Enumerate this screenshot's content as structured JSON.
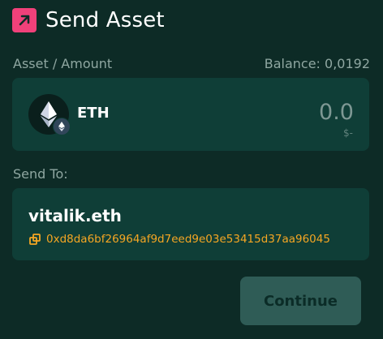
{
  "header": {
    "title": "Send Asset",
    "icon": "arrow-up-right-icon",
    "icon_color": "#f0417a"
  },
  "asset_section": {
    "label": "Asset / Amount",
    "balance_label": "Balance: 0,0192",
    "selected_asset": {
      "symbol": "ETH",
      "icon": "ethereum-icon",
      "network_icon": "ethereum-network-icon"
    },
    "amount": "0.0",
    "fiat_value": "$-"
  },
  "send_to": {
    "label": "Send To:",
    "recipient_name": "vitalik.eth",
    "recipient_address": "0xd8da6bf26964af9d7eed9e03e53415d37aa96045",
    "copy_icon": "copy-icon",
    "address_color": "#f5a623"
  },
  "actions": {
    "continue_label": "Continue"
  },
  "colors": {
    "background": "#0d2b26",
    "card": "#0f3e37",
    "button": "#2f5c56"
  }
}
